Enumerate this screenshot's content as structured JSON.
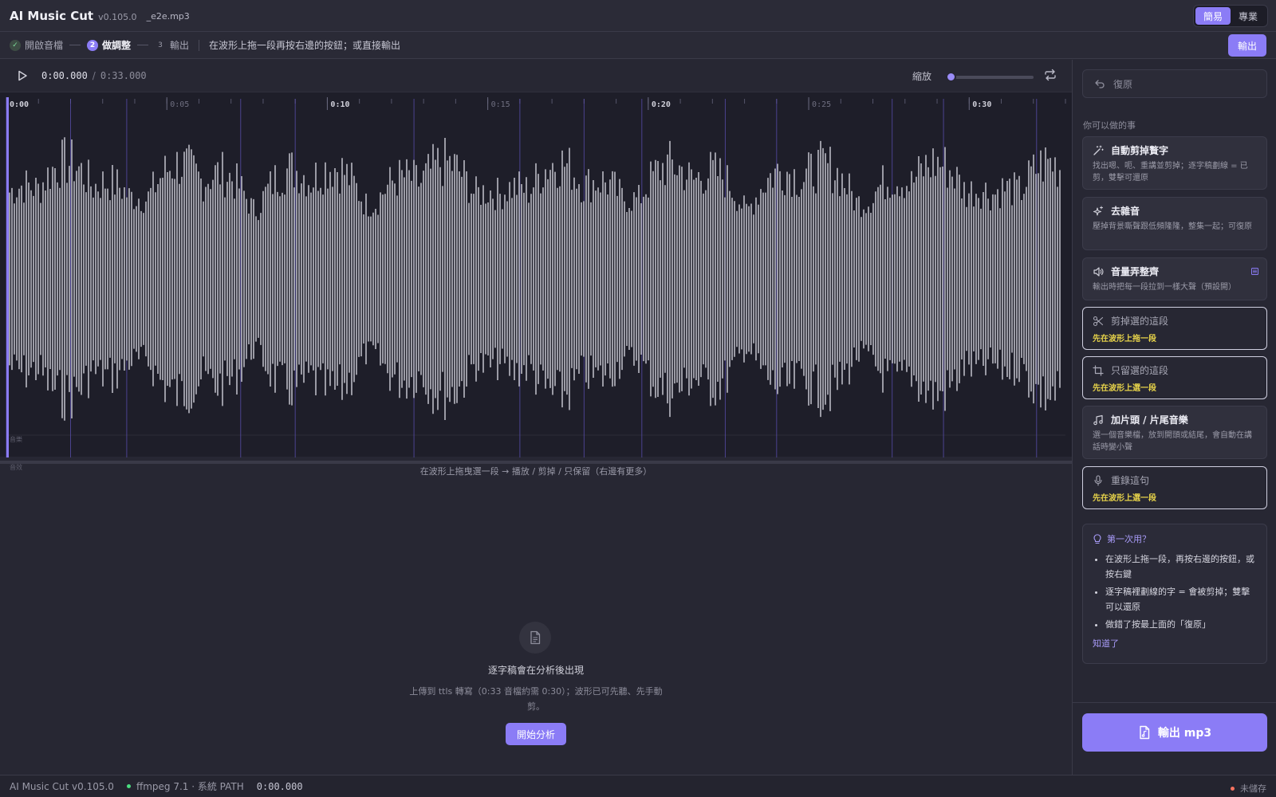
{
  "app": {
    "title": "AI Music Cut",
    "version": "v0.105.0",
    "file_name": "_e2e.mp3"
  },
  "mode_toggle": {
    "simple_label": "簡易",
    "pro_label": "專業",
    "active": "simple"
  },
  "steps": {
    "items": [
      {
        "number": "✓",
        "label": "開啟音檔",
        "state": "done"
      },
      {
        "number": "2",
        "label": "做調整",
        "state": "current"
      },
      {
        "number": "3",
        "label": "輸出",
        "state": "todo"
      }
    ],
    "hint": "在波形上拖一段再按右邊的按鈕；或直接輸出",
    "export_label": "輸出"
  },
  "transport": {
    "current_time": "0:00.000",
    "separator": "/",
    "total_time": "0:33.000",
    "zoom_label": "縮放",
    "zoom_level": 0.0
  },
  "waveform": {
    "time_ticks": [
      "0:00",
      "0:05",
      "0:10",
      "0:15",
      "0:20",
      "0:25",
      "0:30"
    ],
    "duration_seconds": 33,
    "lane_labels": [
      "音樂",
      "音效"
    ],
    "hint": "在波形上拖曳選一段 → 播放 / 剪掉 / 只保留（右邊有更多）"
  },
  "transcript": {
    "title": "逐字稿會在分析後出現",
    "description": "上傳到 ttls 轉寫（0:33 音檔約需 0:30）；波形已可先聽、先手動剪。",
    "analyze_label": "開始分析"
  },
  "side_panel": {
    "undo_label": "復原",
    "section_title": "你可以做的事",
    "actions": [
      {
        "icon": "magic-wand-icon",
        "title": "自動剪掉贅字",
        "desc": "找出嗯、呃、重講並剪掉；逐字稿劃線 = 已剪，雙擊可還原",
        "warn": "",
        "style": "filled"
      },
      {
        "icon": "sparkles-icon",
        "title": "去雜音",
        "desc": "壓掉背景嘶聲跟低頻隆隆，整集一起；可復原",
        "warn": "",
        "style": "filled"
      },
      {
        "icon": "speaker-icon",
        "title": "音量弄整齊",
        "desc": "輸出時把每一段拉到一樣大聲（預設開）",
        "warn": "",
        "style": "filled"
      },
      {
        "icon": "scissors-icon",
        "title": "剪掉選的這段",
        "desc": "",
        "warn": "先在波形上拖一段",
        "style": "outlined"
      },
      {
        "icon": "crop-icon",
        "title": "只留選的這段",
        "desc": "",
        "warn": "先在波形上選一段",
        "style": "outlined"
      },
      {
        "icon": "music-note-icon",
        "title": "加片頭 / 片尾音樂",
        "desc": "選一個音樂檔，放到開頭或結尾，會自動在講話時變小聲",
        "warn": "",
        "style": "filled"
      },
      {
        "icon": "microphone-icon",
        "title": "重錄這句",
        "desc": "",
        "warn": "先在波形上選一段",
        "style": "outlined"
      }
    ],
    "tips": {
      "title": "第一次用？",
      "items": [
        "在波形上拖一段，再按右邊的按鈕，或按右鍵",
        "逐字稿裡劃線的字 = 會被剪掉；雙擊可以還原",
        "做錯了按最上面的「復原」"
      ],
      "ok_label": "知道了"
    },
    "export_label": "輸出 mp3"
  },
  "status_bar": {
    "app": "AI Music Cut v0.105.0",
    "ffmpeg": "ffmpeg 7.1 · 系統 PATH",
    "time": "0:00.000",
    "save_state": "未儲存"
  },
  "colors": {
    "accent": "#8b7cf6",
    "warning": "#e7d34a",
    "ok": "#4ade80",
    "unsaved": "#f97360",
    "waveform": "#c8c8d2"
  }
}
